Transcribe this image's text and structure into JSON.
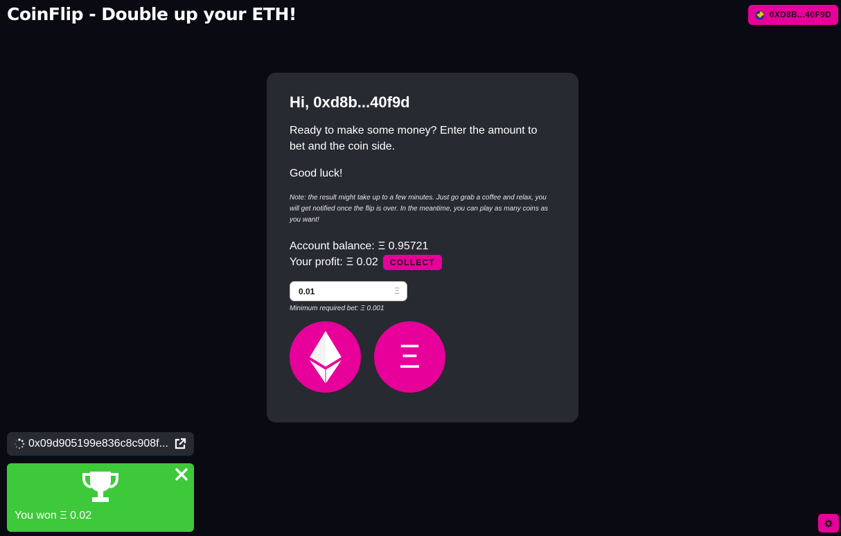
{
  "header": {
    "title": "CoinFlip - Double up your ETH!",
    "wallet_label": "0XD8B...40F9D"
  },
  "card": {
    "greeting": "Hi, 0xd8b...40f9d",
    "intro": "Ready to make some money? Enter the amount to bet and the coin side.",
    "good_luck": "Good luck!",
    "note": "Note: the result might take up to a few minutes. Just go grab a coffee and relax, you will get notified once the flip is over. In the meantime, you can play as many coins as you want!",
    "balance_label": "Account balance:",
    "balance_value": "Ξ 0.95721",
    "profit_label": "Your profit:",
    "profit_value": "Ξ 0.02",
    "collect_label": "COLLECT",
    "bet_value": "0.01",
    "bet_unit": "Ξ",
    "min_bet": "Minimum required bet: Ξ 0.001",
    "coin_heads_icon": "ethereum-diamond-icon",
    "coin_tails_symbol": "Ξ"
  },
  "transaction": {
    "hash": "0x09d905199e836c8c908f...",
    "status_icon": "loading-spinner-icon",
    "link_icon": "external-link-icon"
  },
  "toast": {
    "message": "You won Ξ 0.02",
    "icon": "trophy-icon"
  },
  "colors": {
    "background": "#0a0a12",
    "card": "#272a31",
    "accent": "#e8009a",
    "success": "#3ec93a"
  }
}
